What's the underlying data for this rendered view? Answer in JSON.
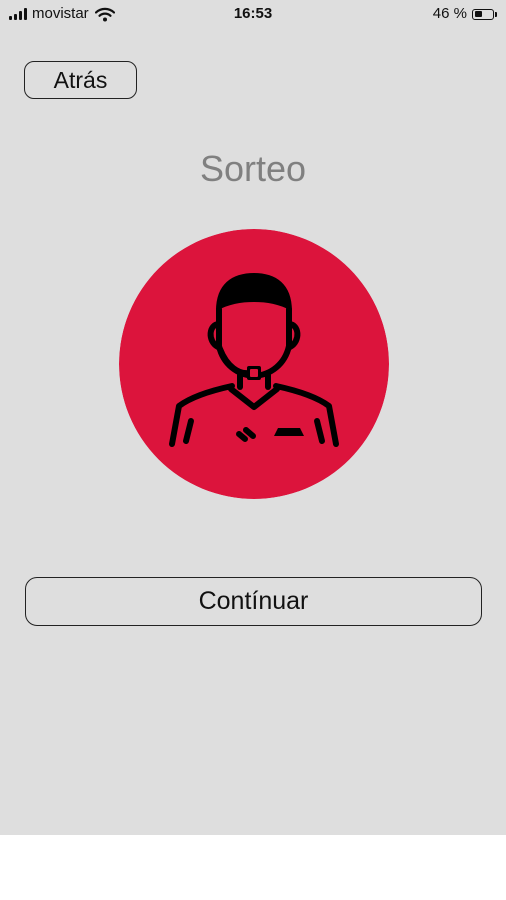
{
  "status_bar": {
    "carrier": "movistar",
    "time": "16:53",
    "battery_percent": "46 %",
    "battery_level": 0.46,
    "icons": [
      "signal-bars-icon",
      "wifi-icon",
      "battery-icon"
    ]
  },
  "nav": {
    "back_label": "Atrás"
  },
  "page": {
    "title": "Sorteo"
  },
  "avatar": {
    "icon": "referee-avatar-icon",
    "circle_color": "#dc143c"
  },
  "actions": {
    "continue_label": "Contínuar"
  },
  "colors": {
    "background": "#dedede",
    "title": "#808080",
    "accent": "#dc143c"
  }
}
